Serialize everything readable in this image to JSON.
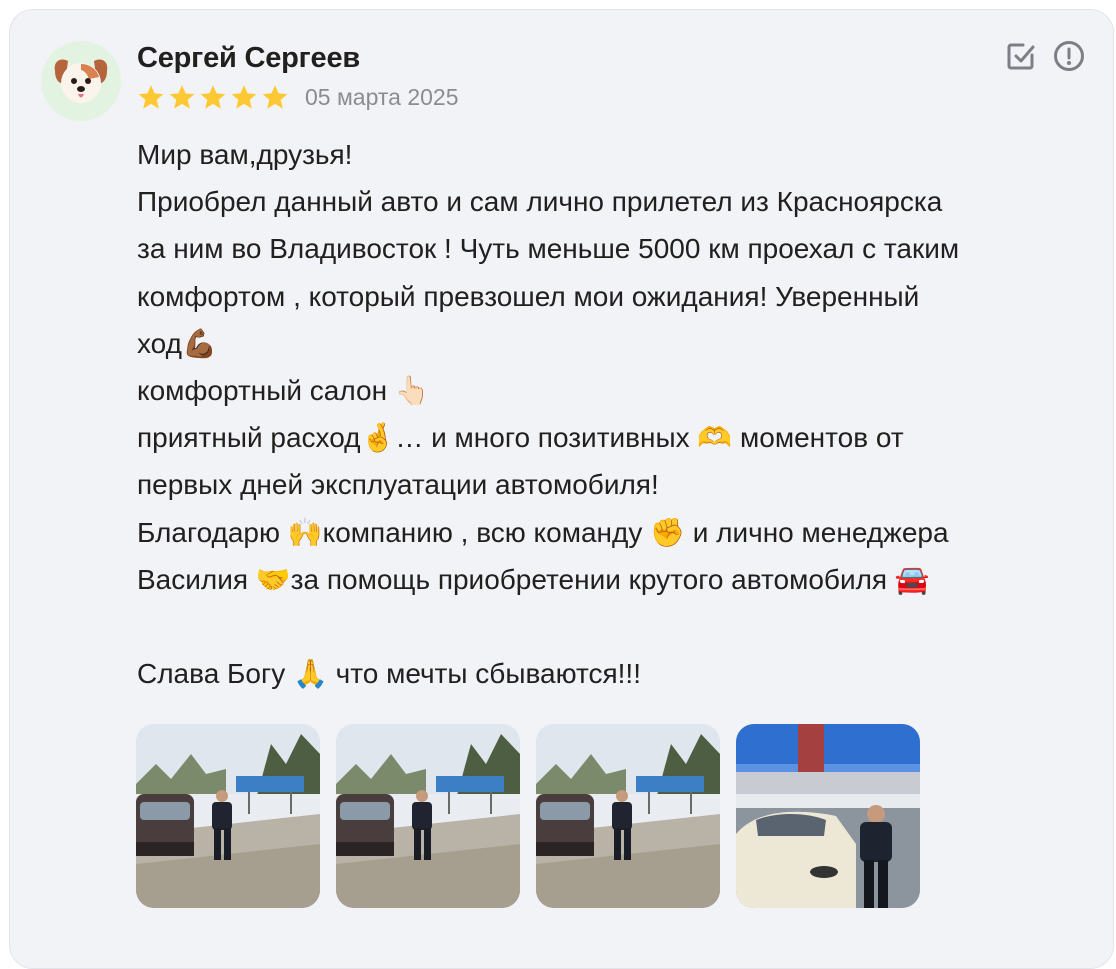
{
  "review": {
    "author": "Сергей Сергеев",
    "rating": 5,
    "rating_max": 5,
    "date": "05 марта 2025",
    "text_lines": [
      "Мир вам,друзья!",
      "Приобрел данный авто и сам лично прилетел из Красноярска",
      "за ним во Владивосток ! Чуть меньше 5000 км проехал с таким",
      "комфортом , который превзошел мои ожидания! Уверенный",
      "ход💪🏾",
      "комфортный салон 👆🏻",
      "приятный расход🤞… и много позитивных 🫶 моментов от",
      "первых дней эксплуатации автомобиля!",
      "Благодарю 🙌компанию , всю команду ✊ и лично менеджера",
      "Василия 🤝за помощь приобретении крутого автомобиля 🚘",
      "",
      "Слава Богу 🙏 что мечты сбываются!!!"
    ],
    "photo_count": 4
  },
  "icons": {
    "avatar": "puppy-face-icon",
    "star": "star-icon",
    "edit": "check-square-icon",
    "report": "exclamation-circle-icon"
  },
  "colors": {
    "card_bg": "#f2f3f6",
    "star": "#fcc934",
    "text": "#21201f",
    "muted": "#8a8c92",
    "icon": "#7c7f88"
  }
}
